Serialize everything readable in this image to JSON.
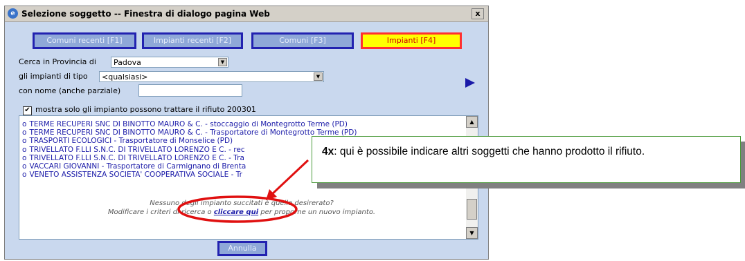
{
  "window": {
    "title": "Selezione soggetto -- Finestra di dialogo pagina Web",
    "close_label": "x",
    "icon": "ie-icon"
  },
  "tabs": [
    {
      "label": "Comuni recenti [F1]"
    },
    {
      "label": "Impianti recenti [F2]"
    },
    {
      "label": "Comuni [F3]"
    },
    {
      "label": "Impianti [F4]",
      "active": true
    }
  ],
  "filters": {
    "province_label": "Cerca in Provincia di",
    "province_value": "Padova",
    "type_label": "gli impianti di tipo",
    "type_value": "<qualsiasi>",
    "name_label": "con nome (anche parziale)",
    "name_value": "",
    "checkbox_label": "mostra solo gli impianto possono trattare il rifiuto 200301",
    "checkbox_checked": true
  },
  "results": [
    "TERME RECUPERI SNC DI BINOTTO MAURO & C. - stoccaggio di Montegrotto Terme (PD)",
    "TERME RECUPERI SNC DI BINOTTO MAURO & C. - Trasportatore di Montegrotto Terme (PD)",
    "TRASPORTI ECOLOGICI - Trasportatore di Monselice (PD)",
    "TRIVELLATO F.LLI S.N.C. DI TRIVELLATO LORENZO E C. - rec",
    "TRIVELLATO F.LLI S.N.C. DI TRIVELLATO LORENZO E C. - Tra",
    "VACCARI GIOVANNI - Trasportatore di Carmignano di Brenta",
    "VENETO ASSISTENZA SOCIETA' COOPERATIVA SOCIALE - Tr"
  ],
  "notice": {
    "line1": "Nessuno degli impianto succitati è quello desirerato?",
    "line2_prefix": "Modificare i criteri di ricerca o ",
    "link": "cliccare qui",
    "line2_suffix": " per proporne un nuovo impianto."
  },
  "cancel_label": "Annulla",
  "callout": {
    "bold": "4x",
    "text": ": qui è possibile indicare altri soggetti che hanno prodotto il rifiuto."
  },
  "colors": {
    "dialog_bg": "#c9d8ee",
    "tab_border": "#2222b0",
    "active_tab_bg": "#ffff00",
    "active_tab_text": "#cc0000",
    "link": "#1a1aa8",
    "annotation": "#e01010",
    "callout_border": "#4a9a3a"
  }
}
